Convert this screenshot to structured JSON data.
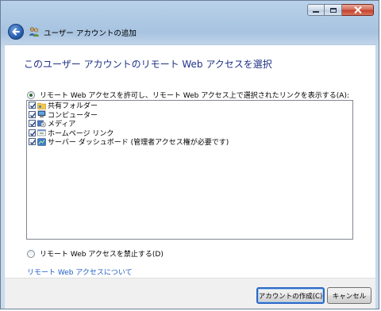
{
  "window": {
    "title": "ユーザー アカウントの追加",
    "controls": {
      "minimize": "minimize",
      "maximize": "maximize",
      "close": "close"
    }
  },
  "main": {
    "heading": "このユーザー アカウントのリモート Web アクセスを選択",
    "option_allow": {
      "label": "リモート Web アクセスを許可し、リモート Web アクセス上で選択されたリンクを表示する(A):",
      "checked": true
    },
    "links": [
      {
        "label": "共有フォルダー",
        "checked": true,
        "icon": "shared-folder-icon"
      },
      {
        "label": "コンピューター",
        "checked": true,
        "icon": "computer-icon"
      },
      {
        "label": "メディア",
        "checked": true,
        "icon": "media-icon"
      },
      {
        "label": "ホームページ リンク",
        "checked": true,
        "icon": "home-page-link-icon"
      },
      {
        "label": "サーバー ダッシュボード (管理者アクセス権が必要です)",
        "checked": true,
        "icon": "server-dashboard-icon"
      }
    ],
    "option_deny": {
      "label": "リモート Web アクセスを禁止する(D)",
      "checked": false
    },
    "about_link": "リモート Web アクセスについて"
  },
  "footer": {
    "create_button": "アカウントの作成(C)",
    "cancel_button": "キャンセル"
  },
  "colors": {
    "heading": "#1e3287",
    "link": "#1f5ec4",
    "close_button": "#c4412c"
  }
}
